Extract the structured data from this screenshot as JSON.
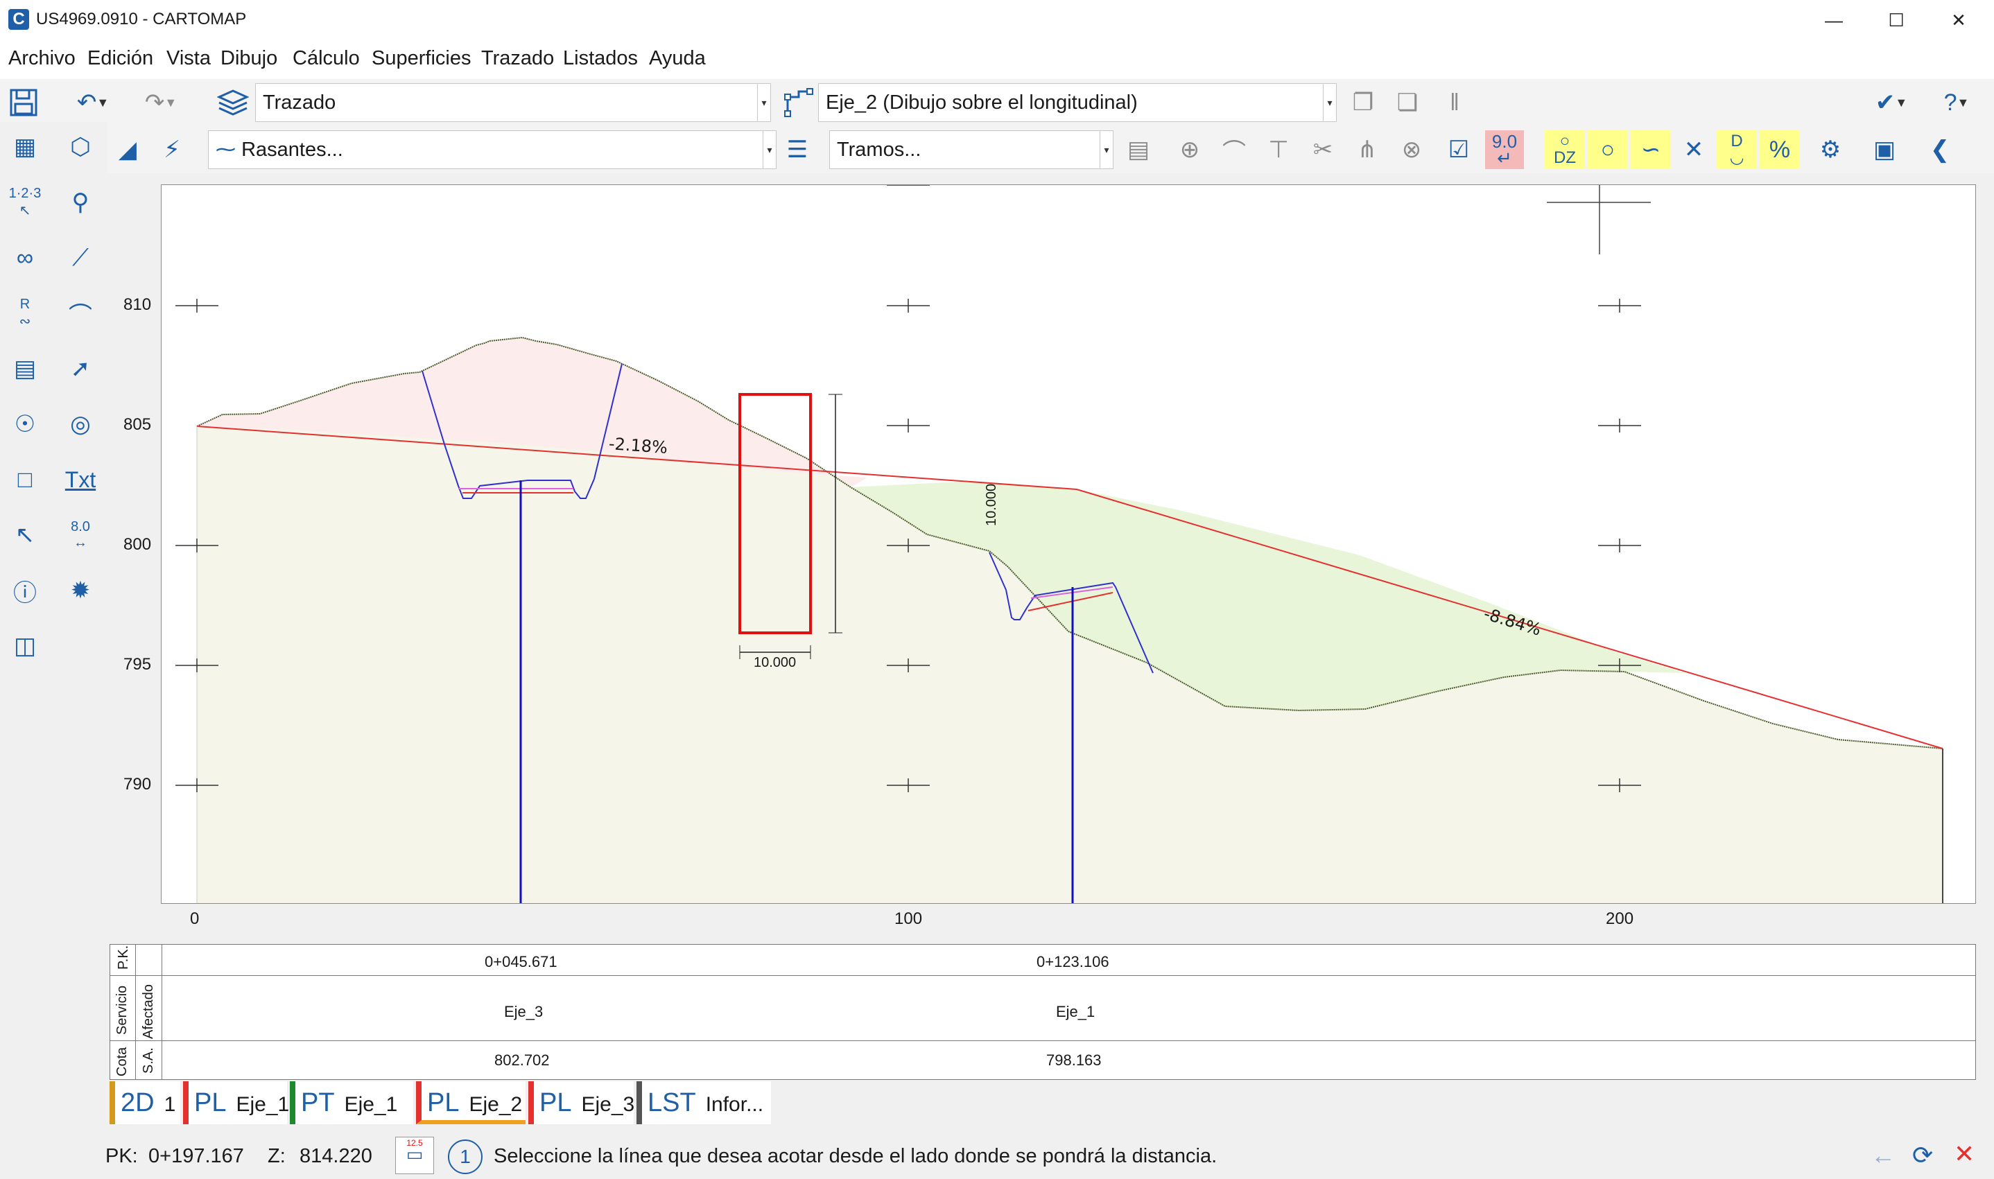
{
  "window": {
    "title": "US4969.0910 - CARTOMAP",
    "app_letter": "C"
  },
  "menu": [
    "Archivo",
    "Edición",
    "Vista",
    "Dibujo",
    "Cálculo",
    "Superficies",
    "Trazado",
    "Listados",
    "Ayuda"
  ],
  "toolbar": {
    "layer_combo": "Trazado",
    "axis_combo": "Eje_2 (Dibujo sobre el longitudinal)",
    "rasantes_combo": "Rasantes...",
    "tramos_combo": "Tramos...",
    "value_90": "9.0",
    "dz": "DZ",
    "d": "D",
    "pct": "%"
  },
  "leftbar": {
    "num_label": "1·2·3",
    "r_label": "R",
    "txt_label": "Txt",
    "dim_label": "8.0"
  },
  "profile": {
    "y_labels": [
      "810",
      "805",
      "800",
      "795",
      "790"
    ],
    "x_labels": [
      "0",
      "100",
      "200"
    ],
    "slope_1": "-2.18%",
    "slope_2": "-8.84%",
    "dim_horizontal": "10.000",
    "dim_vertical": "10.000"
  },
  "guitar": {
    "row_pk": "P.K.",
    "row_servicio_a": "Servicio",
    "row_servicio_b": "Afectado",
    "row_cota_a": "Cota",
    "row_cota_b": "S.A.",
    "pk_values": [
      "0+045.671",
      "0+123.106"
    ],
    "service_values": [
      "Eje_3",
      "Eje_1"
    ],
    "cota_values": [
      "802.702",
      "798.163"
    ]
  },
  "tabs": [
    {
      "type": "2D",
      "label": "1",
      "color": "#d49a1a"
    },
    {
      "type": "PL",
      "label": "Eje_1",
      "color": "#e53030"
    },
    {
      "type": "PT",
      "label": "Eje_1 ...",
      "color": "#1e8a2e"
    },
    {
      "type": "PL",
      "label": "Eje_2",
      "color": "#e53030"
    },
    {
      "type": "PL",
      "label": "Eje_3",
      "color": "#e53030"
    },
    {
      "type": "LST",
      "label": "Infor...",
      "color": "#555555"
    }
  ],
  "status": {
    "pk_label": "PK:",
    "pk_value": "0+197.167",
    "z_label": "Z:",
    "z_value": "814.220",
    "icon_value": "12.5",
    "step": "1",
    "message": "Seleccione la línea que desea acotar desde el lado donde se pondrá la distancia."
  }
}
